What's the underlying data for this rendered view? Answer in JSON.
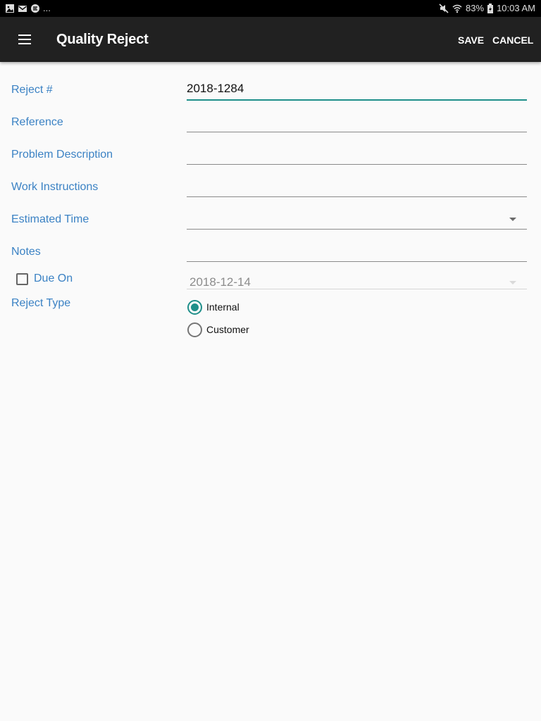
{
  "status_bar": {
    "left_icons": [
      "image-icon",
      "mail-icon",
      "sync-icon"
    ],
    "overflow": "...",
    "right_icons": [
      "mute-icon",
      "wifi-icon"
    ],
    "battery": "83%",
    "time": "10:03 AM"
  },
  "app_bar": {
    "menu_icon": "hamburger-menu-icon",
    "title": "Quality Reject",
    "save_label": "SAVE",
    "cancel_label": "CANCEL"
  },
  "form": {
    "reject_no": {
      "label": "Reject #",
      "value": "2018-1284"
    },
    "reference": {
      "label": "Reference",
      "value": ""
    },
    "problem_description": {
      "label": "Problem Description",
      "value": ""
    },
    "work_instructions": {
      "label": "Work Instructions",
      "value": ""
    },
    "estimated_time": {
      "label": "Estimated Time",
      "value": ""
    },
    "notes": {
      "label": "Notes",
      "value": ""
    },
    "due_on": {
      "label": "Due On",
      "checked": false,
      "value": "2018-12-14"
    },
    "reject_type": {
      "label": "Reject Type",
      "options": [
        {
          "label": "Internal",
          "selected": true
        },
        {
          "label": "Customer",
          "selected": false
        }
      ]
    }
  },
  "colors": {
    "accent": "#1f8f8a",
    "label": "#3b82c4",
    "app_bar": "#212121"
  }
}
